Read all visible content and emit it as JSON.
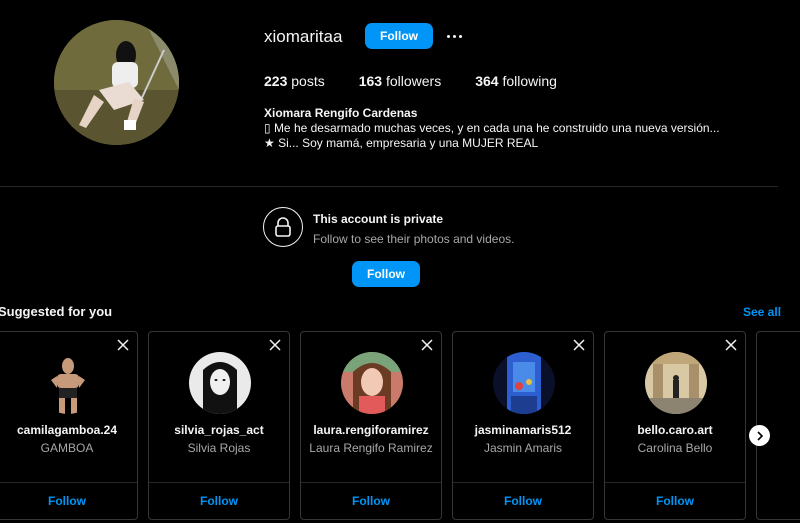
{
  "profile": {
    "username": "xiomaritaa",
    "follow_label": "Follow",
    "posts_count": "223",
    "posts_label": " posts",
    "followers_count": "163",
    "followers_label": " followers",
    "following_count": "364",
    "following_label": " following",
    "full_name": "Xiomara Rengifo Cardenas",
    "bio_line1": "▯ Me he desarmado muchas veces, y en cada una he construido una nueva versión...",
    "bio_line2": "★ Si... Soy mamá, empresaria y una MUJER REAL"
  },
  "private": {
    "title": "This account is private",
    "subtitle": "Follow to see their photos and videos.",
    "follow_label": "Follow"
  },
  "suggested": {
    "title": "Suggested for you",
    "see_all": "See all",
    "cards": [
      {
        "username": "camilagamboa.24",
        "name": "GAMBOA",
        "follow": "Follow"
      },
      {
        "username": "silvia_rojas_act",
        "name": "Silvia Rojas",
        "follow": "Follow"
      },
      {
        "username": "laura.rengiforamirez",
        "name": "Laura Rengifo Ramirez",
        "follow": "Follow"
      },
      {
        "username": "jasminamaris512",
        "name": "Jasmin Amaris",
        "follow": "Follow"
      },
      {
        "username": "bello.caro.art",
        "name": "Carolina Bello",
        "follow": "Follow"
      }
    ]
  },
  "colors": {
    "accent": "#0095f6",
    "background": "#000000",
    "secondary_text": "#a8a8a8"
  },
  "icons": [
    "more-options-icon",
    "lock-icon",
    "close-icon",
    "chevron-right-icon"
  ]
}
